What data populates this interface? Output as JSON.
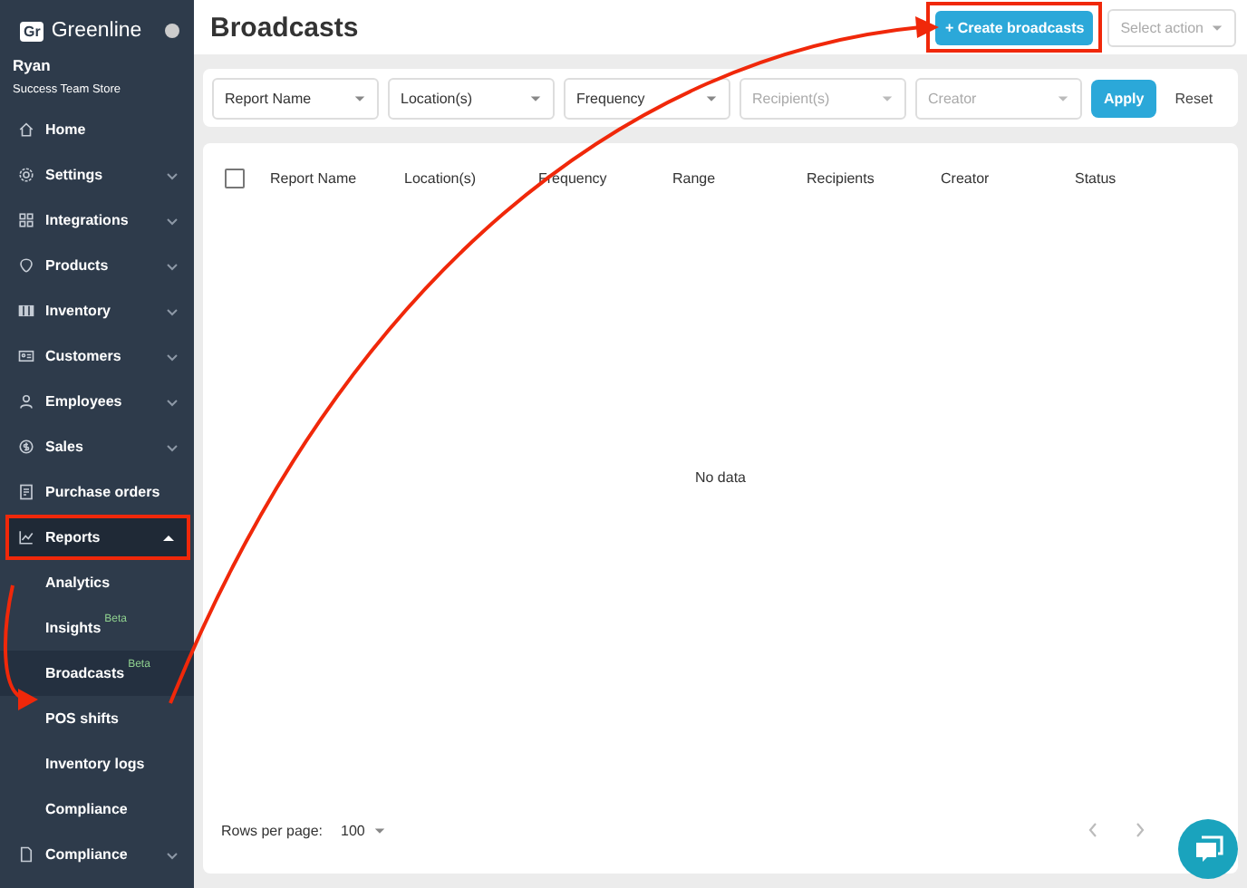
{
  "sidebar": {
    "logo": {
      "mark": "Gr",
      "text": "Greenline"
    },
    "user": {
      "name": "Ryan",
      "store": "Success Team Store"
    },
    "items": [
      {
        "label": "Home",
        "selected": false
      },
      {
        "label": "Settings",
        "expanded": false,
        "selected": false
      },
      {
        "label": "Integrations",
        "expanded": false,
        "selected": false
      },
      {
        "label": "Products",
        "expanded": false,
        "selected": false
      },
      {
        "label": "Inventory",
        "expanded": false,
        "selected": false
      },
      {
        "label": "Customers",
        "expanded": false,
        "selected": false
      },
      {
        "label": "Employees",
        "expanded": false,
        "selected": false
      },
      {
        "label": "Sales",
        "expanded": false,
        "selected": false
      },
      {
        "label": "Purchase orders",
        "selected": false
      },
      {
        "label": "Reports",
        "expanded": true,
        "selected": true,
        "annotated": true,
        "children": [
          {
            "label": "Analytics",
            "selected": false
          },
          {
            "label": "Insights",
            "badge": "Beta",
            "selected": false
          },
          {
            "label": "Broadcasts",
            "badge": "Beta",
            "selected": true
          },
          {
            "label": "POS shifts",
            "selected": false
          },
          {
            "label": "Inventory logs",
            "selected": false
          },
          {
            "label": "Compliance",
            "selected": false
          }
        ]
      },
      {
        "label": "Compliance",
        "expanded": false,
        "selected": false
      }
    ]
  },
  "header": {
    "title": "Broadcasts",
    "create_button": {
      "label": "+ Create broadcasts",
      "annotated": true
    },
    "action_select": {
      "placeholder": "Select action"
    }
  },
  "filters": {
    "dropdowns": [
      {
        "value": "Report Name"
      },
      {
        "value": "Location(s)"
      },
      {
        "value": "Frequency"
      },
      {
        "placeholder": "Recipient(s)"
      },
      {
        "placeholder": "Creator"
      }
    ],
    "apply": "Apply",
    "reset": "Reset"
  },
  "table": {
    "select_all": {
      "checked": false
    },
    "columns": [
      "Report Name",
      "Location(s)",
      "Frequency",
      "Range",
      "Recipients",
      "Creator",
      "Status"
    ],
    "empty_text": "No data"
  },
  "footer": {
    "rows_per_page_label": "Rows per page:",
    "rows_per_page": "100"
  }
}
